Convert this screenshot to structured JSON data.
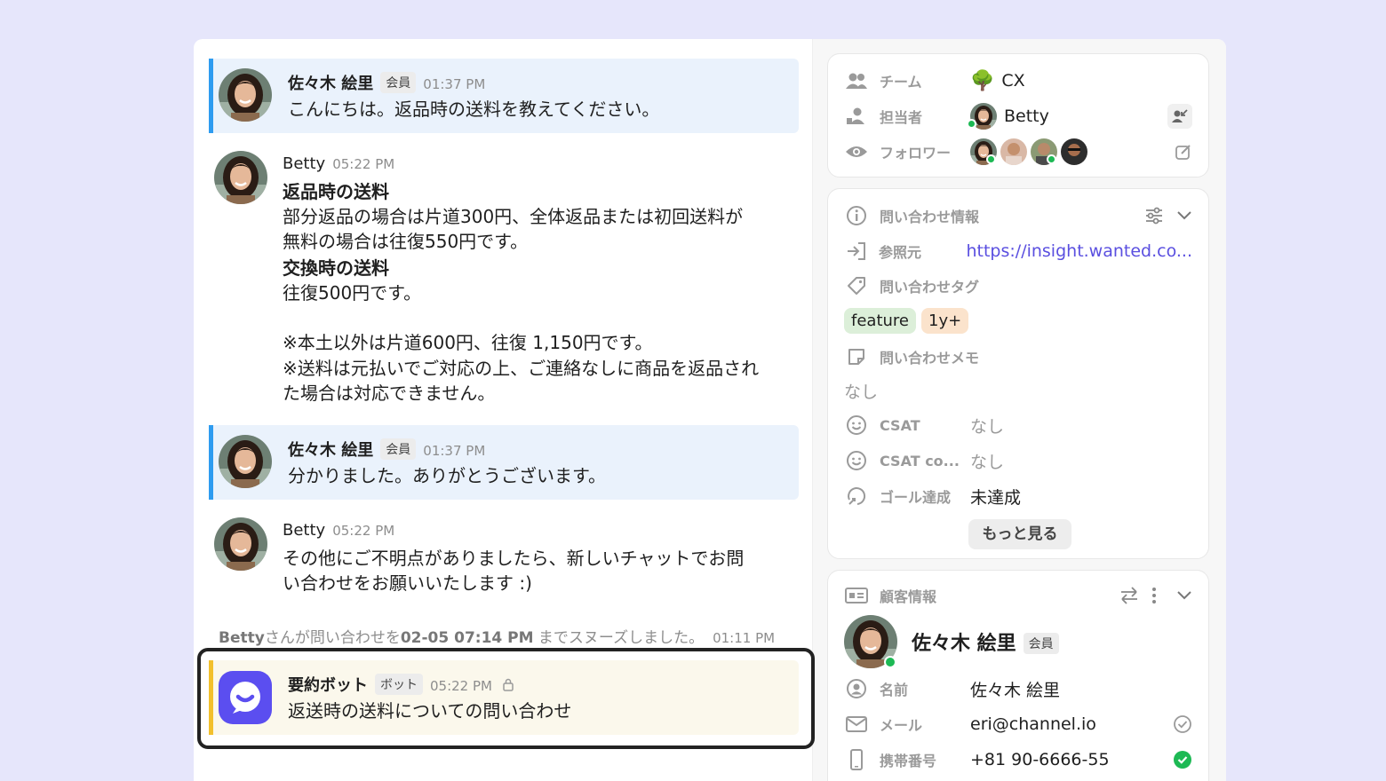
{
  "chat": {
    "messages": [
      {
        "sender": "佐々木 絵里",
        "badge": "会員",
        "time": "01:37 PM",
        "text": "こんにちは。返品時の送料を教えてください。"
      },
      {
        "sender": "Betty",
        "time": "05:22 PM",
        "lines": [
          "返品時の送料",
          "部分返品の場合は片道300円、全体返品または初回送料が",
          "無料の場合は往復550円です。",
          "交換時の送料",
          "往復500円です。",
          "",
          "※本土以外は片道600円、往復 1,150円です。",
          "※送料は元払いでご対応の上、ご連絡なしに商品を返品され",
          "た場合は対応できません。"
        ]
      },
      {
        "sender": "佐々木 絵里",
        "badge": "会員",
        "time": "01:37 PM",
        "text": "分かりました。ありがとうございます。"
      },
      {
        "sender": "Betty",
        "time": "05:22 PM",
        "lines": [
          "その他にご不明点がありましたら、新しいチャットでお問",
          "い合わせをお願いいたします :)"
        ]
      }
    ],
    "system": {
      "actor": "Betty",
      "mid": "さんが問い合わせを",
      "date": "02-05 07:14 PM",
      "tail": " までスヌーズしました。",
      "time": "01:11 PM"
    },
    "bot": {
      "sender": "要約ボット",
      "badge": "ボット",
      "time": "05:22 PM",
      "text": "返送時の送料についての問い合わせ"
    }
  },
  "sidebar": {
    "assignment": {
      "team_label": "チーム",
      "team_value": "CX",
      "assignee_label": "担当者",
      "assignee_value": "Betty",
      "followers_label": "フォロワー"
    },
    "inquiry": {
      "title": "問い合わせ情報",
      "referrer_label": "参照元",
      "referrer_value": "https://insight.wanted.co...",
      "tags_label": "問い合わせタグ",
      "tags": [
        {
          "text": "feature",
          "color": "#dcefd9"
        },
        {
          "text": "1y+",
          "color": "#fbe3cc"
        }
      ],
      "memo_label": "問い合わせメモ",
      "memo_value": "なし",
      "csat_label": "CSAT",
      "csat_value": "なし",
      "csat_comment_label": "CSAT co...",
      "csat_comment_value": "なし",
      "goal_label": "ゴール達成",
      "goal_value": "未達成",
      "more_button": "もっと見る"
    },
    "customer": {
      "title": "顧客情報",
      "name": "佐々木 絵里",
      "badge": "会員",
      "name_label": "名前",
      "name_value": "佐々木 絵里",
      "email_label": "メール",
      "email_value": "eri@channel.io",
      "phone_label": "携帯番号",
      "phone_value": "+81 90-6666-55"
    }
  },
  "colors": {
    "accent_blue": "#2e9cf0",
    "accent_yellow": "#f2c02d",
    "bot_purple": "#5b4ef0",
    "online": "#1db954",
    "link": "#5a4fe0"
  }
}
